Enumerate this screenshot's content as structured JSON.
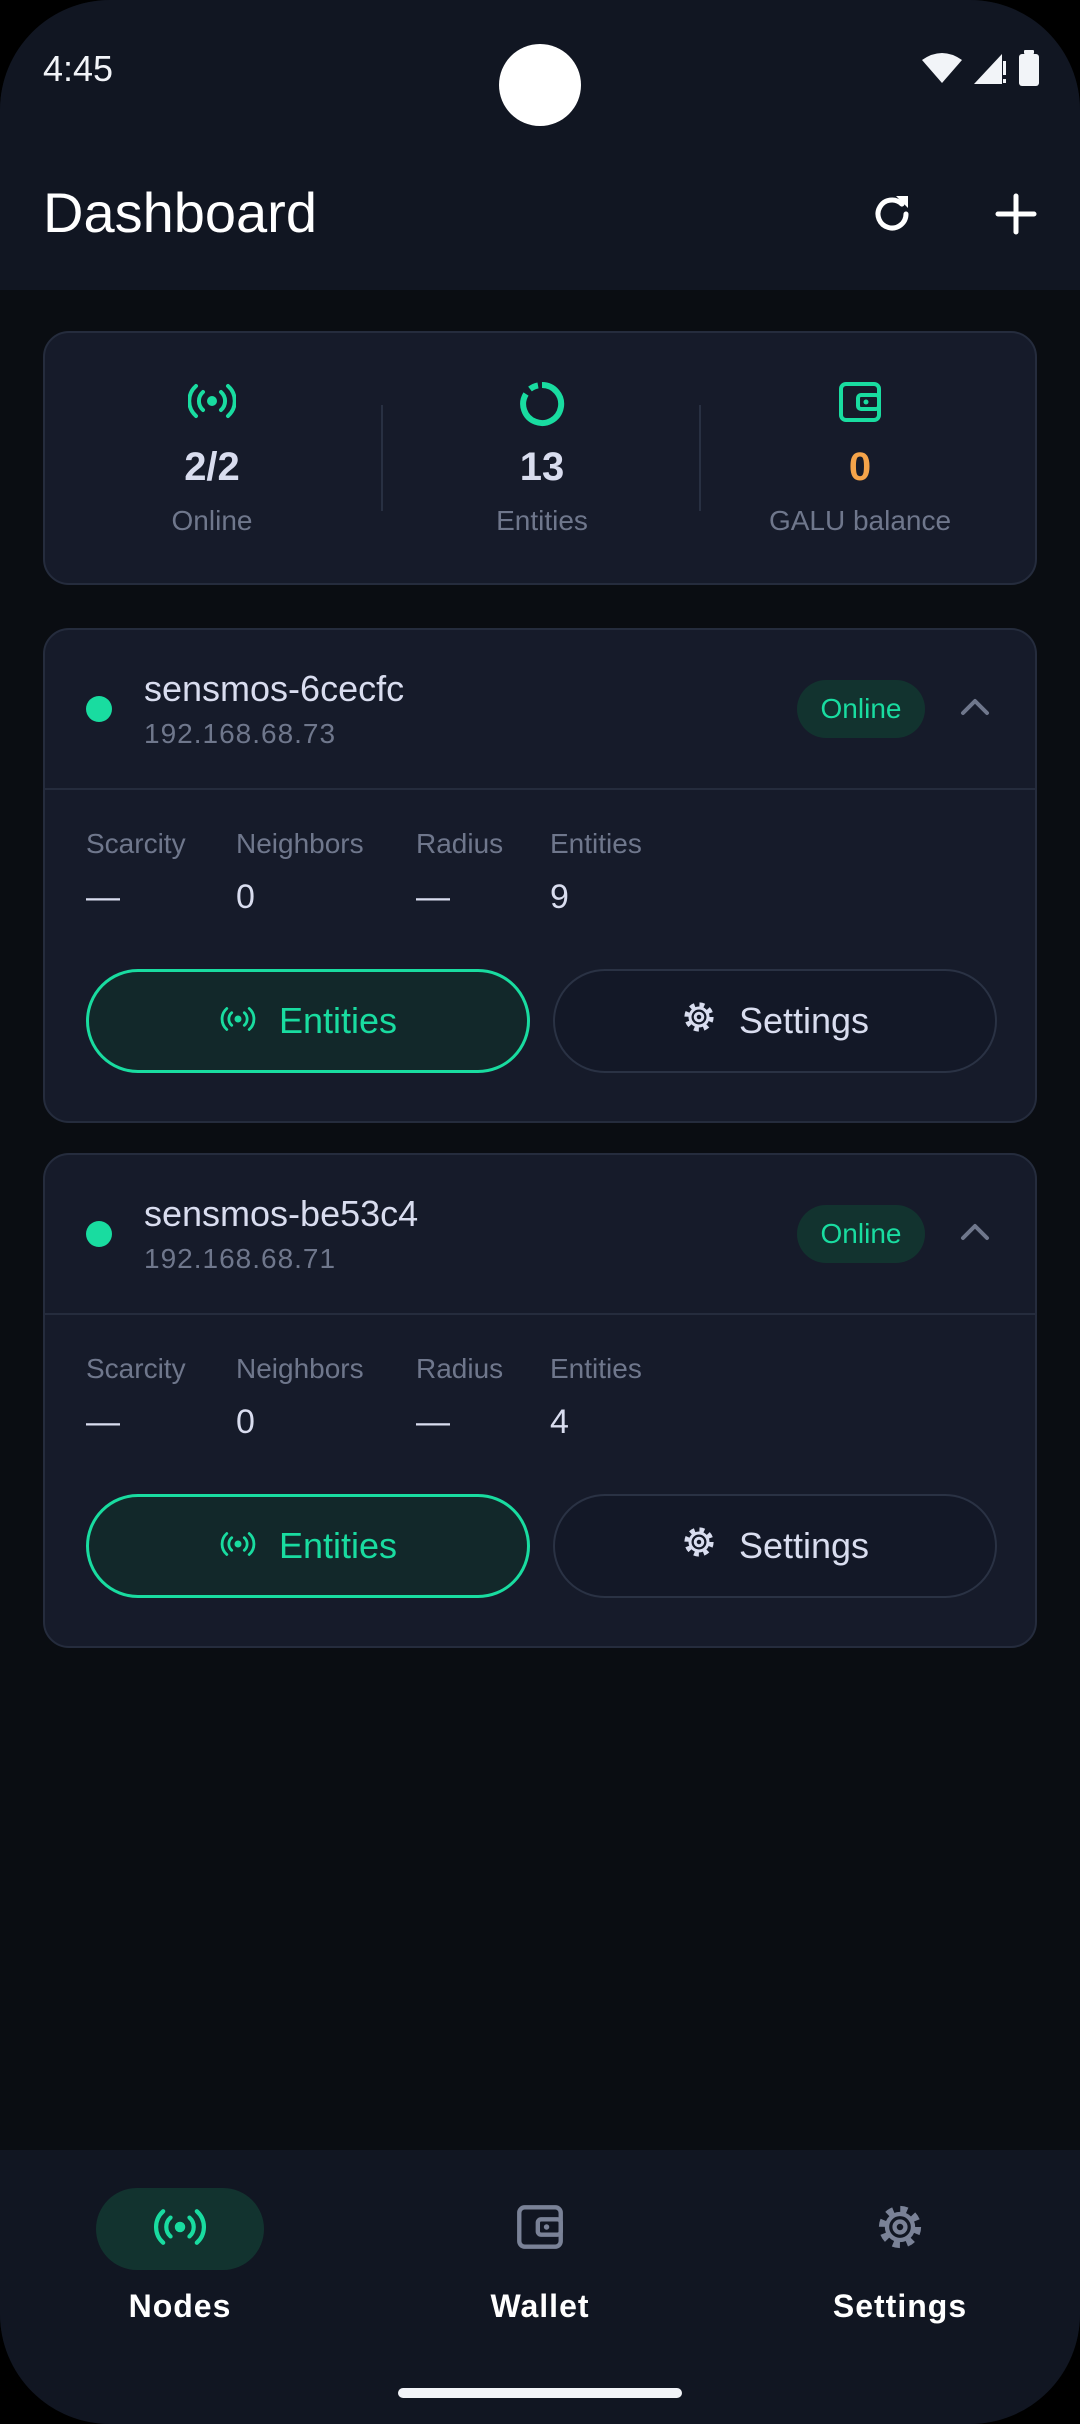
{
  "status_bar": {
    "time": "4:45"
  },
  "header": {
    "title": "Dashboard"
  },
  "summary": {
    "online": {
      "value": "2/2",
      "label": "Online"
    },
    "entities": {
      "value": "13",
      "label": "Entities"
    },
    "balance": {
      "value": "0",
      "label": "GALU balance"
    }
  },
  "nodes": [
    {
      "name": "sensmos-6cecfc",
      "ip": "192.168.68.73",
      "status": "Online",
      "metrics": [
        {
          "label": "Scarcity",
          "value": "—"
        },
        {
          "label": "Neighbors",
          "value": "0"
        },
        {
          "label": "Radius",
          "value": "—"
        },
        {
          "label": "Entities",
          "value": "9"
        }
      ],
      "entities_button": "Entities",
      "settings_button": "Settings"
    },
    {
      "name": "sensmos-be53c4",
      "ip": "192.168.68.71",
      "status": "Online",
      "metrics": [
        {
          "label": "Scarcity",
          "value": "—"
        },
        {
          "label": "Neighbors",
          "value": "0"
        },
        {
          "label": "Radius",
          "value": "—"
        },
        {
          "label": "Entities",
          "value": "4"
        }
      ],
      "entities_button": "Entities",
      "settings_button": "Settings"
    }
  ],
  "bottom_nav": [
    {
      "label": "Nodes",
      "icon": "broadcast-icon",
      "active": true
    },
    {
      "label": "Wallet",
      "icon": "wallet-icon",
      "active": false
    },
    {
      "label": "Settings",
      "icon": "gear-icon",
      "active": false
    }
  ],
  "colors": {
    "accent": "#19dca0",
    "balance": "#f5a44a",
    "background": "#0a0d12",
    "surface": "#161b2a",
    "bar": "#111622"
  }
}
